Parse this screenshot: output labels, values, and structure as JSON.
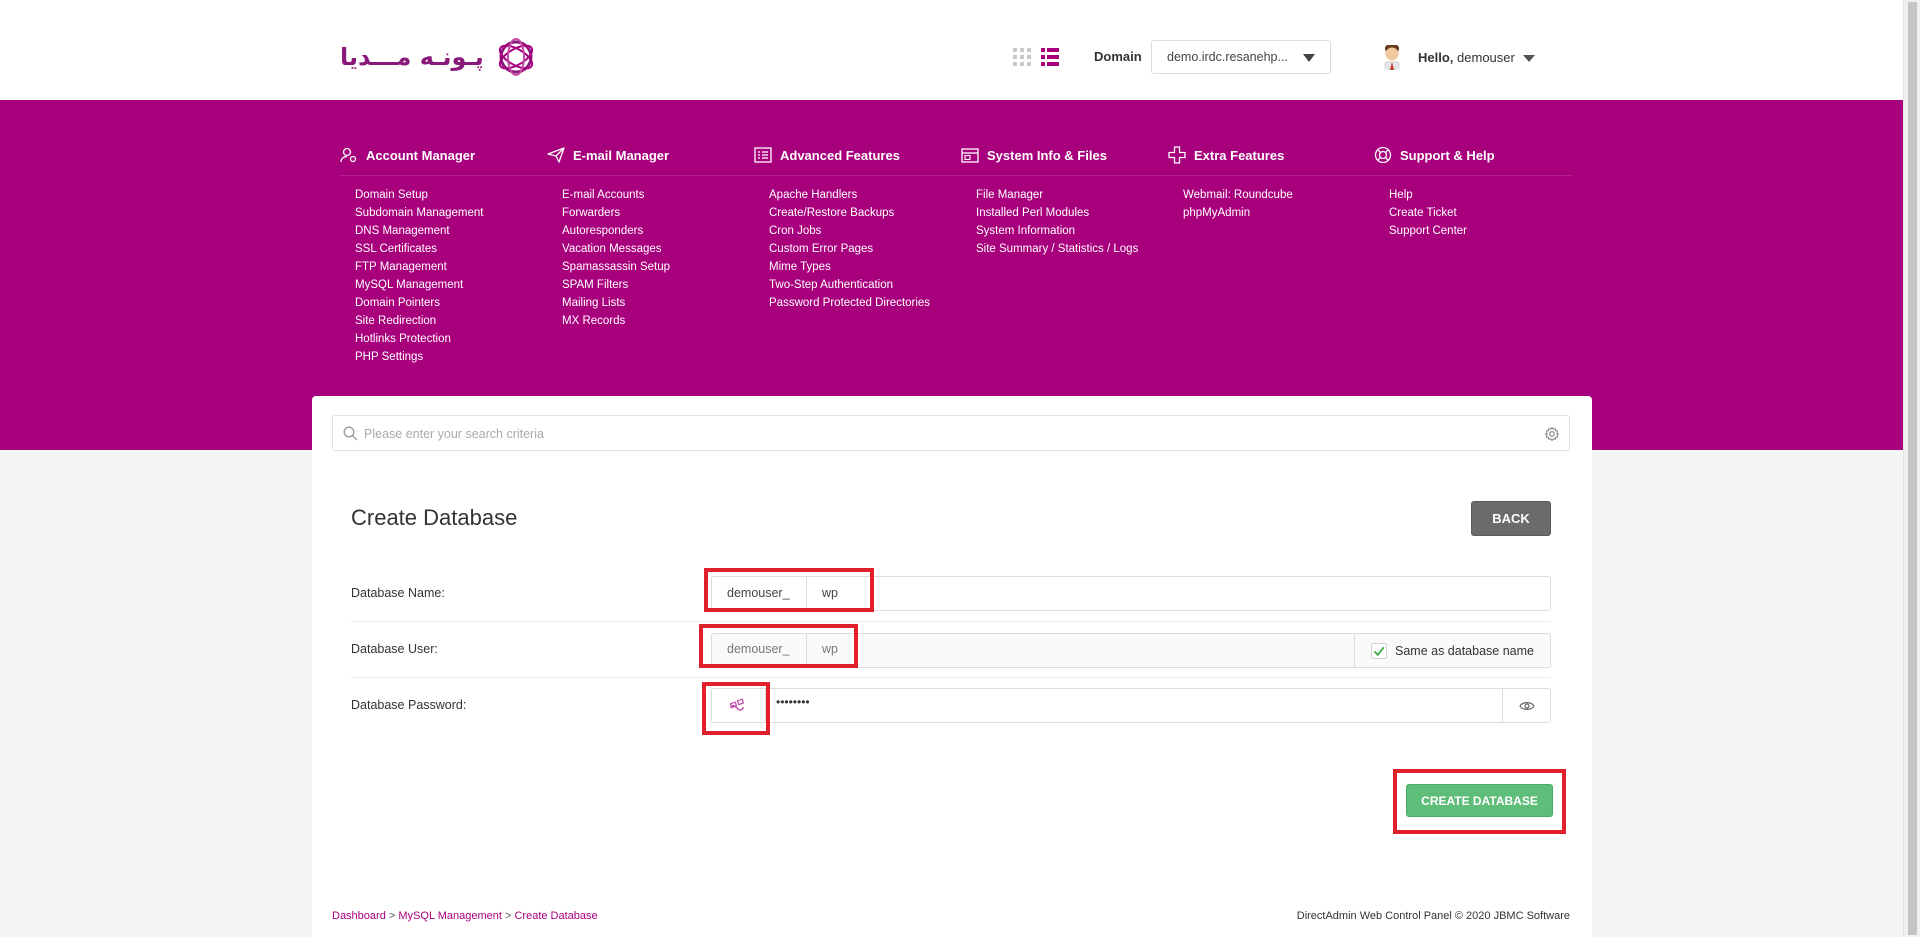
{
  "header": {
    "logo_text": "پـونـه مـــديا",
    "domain_label": "Domain",
    "domain_value": "demo.irdc.resanehp...",
    "hello_prefix": "Hello,",
    "username": "demouser"
  },
  "menu": [
    {
      "title": "Account Manager",
      "icon": "user-gear-icon",
      "items": [
        "Domain Setup",
        "Subdomain Management",
        "DNS Management",
        "SSL Certificates",
        "FTP Management",
        "MySQL Management",
        "Domain Pointers",
        "Site Redirection",
        "Hotlinks Protection",
        "PHP Settings"
      ]
    },
    {
      "title": "E-mail Manager",
      "icon": "paper-plane-icon",
      "items": [
        "E-mail Accounts",
        "Forwarders",
        "Autoresponders",
        "Vacation Messages",
        "Spamassassin Setup",
        "SPAM Filters",
        "Mailing Lists",
        "MX Records"
      ]
    },
    {
      "title": "Advanced Features",
      "icon": "list-panel-icon",
      "items": [
        "Apache Handlers",
        "Create/Restore Backups",
        "Cron Jobs",
        "Custom Error Pages",
        "Mime Types",
        "Two-Step Authentication",
        "Password Protected Directories"
      ]
    },
    {
      "title": "System Info & Files",
      "icon": "folder-window-icon",
      "items": [
        "File Manager",
        "Installed Perl Modules",
        "System Information",
        "Site Summary / Statistics / Logs"
      ]
    },
    {
      "title": "Extra Features",
      "icon": "plus-outline-icon",
      "items": [
        "Webmail: Roundcube",
        "phpMyAdmin"
      ]
    },
    {
      "title": "Support & Help",
      "icon": "lifebuoy-icon",
      "items": [
        "Help",
        "Create Ticket",
        "Support Center"
      ]
    }
  ],
  "search": {
    "placeholder": "Please enter your search criteria"
  },
  "form": {
    "title": "Create Database",
    "back_label": "BACK",
    "db_name_label": "Database Name:",
    "db_name_prefix": "demouser_",
    "db_name_value": "wp",
    "db_user_label": "Database User:",
    "db_user_prefix": "demouser_",
    "db_user_value": "wp",
    "same_as_label": "Same as database name",
    "same_as_checked": true,
    "db_password_label": "Database Password:",
    "db_password_value": "••••••••",
    "create_label": "CREATE DATABASE"
  },
  "breadcrumb": {
    "items": [
      "Dashboard",
      "MySQL Management",
      "Create Database"
    ],
    "separator": ">"
  },
  "footer": {
    "copyright": "DirectAdmin Web Control Panel © 2020 JBMC Software"
  },
  "colors": {
    "brand": "#a8007d",
    "success": "#5fbd7a",
    "highlight": "#e0202a"
  }
}
